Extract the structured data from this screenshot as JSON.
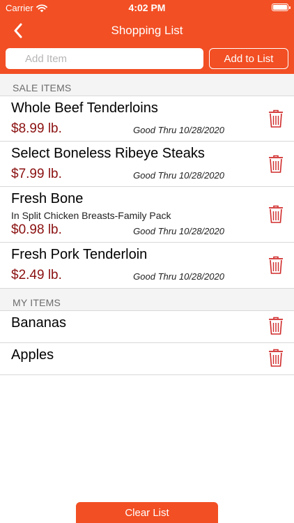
{
  "status_bar": {
    "carrier": "Carrier",
    "time": "4:02 PM"
  },
  "header": {
    "title": "Shopping List"
  },
  "add_item": {
    "placeholder": "Add Item",
    "button_label": "Add to List"
  },
  "sale_items": {
    "header": "SALE ITEMS",
    "items": [
      {
        "name": "Whole Beef Tenderloins",
        "price": "$8.99 lb.",
        "good_thru": "Good Thru 10/28/2020"
      },
      {
        "name": "Select Boneless Ribeye Steaks",
        "price": "$7.99 lb.",
        "good_thru": "Good Thru 10/28/2020"
      },
      {
        "name": "Fresh Bone",
        "subtitle": "In Split Chicken Breasts-Family Pack",
        "price": "$0.98 lb.",
        "good_thru": "Good Thru 10/28/2020"
      },
      {
        "name": "Fresh Pork Tenderloin",
        "price": "$2.49 lb.",
        "good_thru": "Good Thru 10/28/2020"
      }
    ]
  },
  "my_items": {
    "header": "MY ITEMS",
    "items": [
      {
        "name": "Bananas"
      },
      {
        "name": "Apples"
      }
    ]
  },
  "footer": {
    "clear_label": "Clear List"
  },
  "colors": {
    "brand": "#f24f24",
    "price": "#8b1010",
    "trash": "#d02a2a"
  },
  "icons": {
    "back": "chevron-left-icon",
    "delete": "trash-icon",
    "wifi": "wifi-icon",
    "battery": "battery-icon"
  }
}
